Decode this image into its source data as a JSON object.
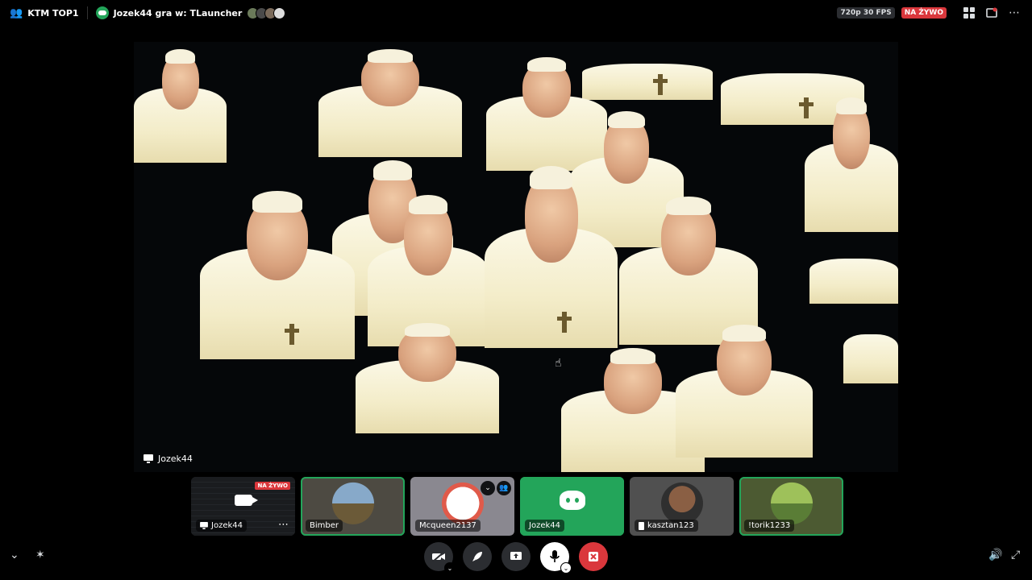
{
  "topbar": {
    "channel_name": "KTM TOP1",
    "activity": "Jozek44 gra w: TLauncher",
    "quality": "720p 30 FPS",
    "live_label": "NA ŻYWO",
    "activity_avatar_colors": [
      "#6b7a5a",
      "#4a4a4a",
      "#7a6a5a",
      "#dddddd"
    ]
  },
  "stream": {
    "streamer_label": "Jozek44"
  },
  "participants": [
    {
      "name": "Jozek44",
      "type": "screen",
      "live_label": "NA ŻYWO",
      "active": false
    },
    {
      "name": "Bimber",
      "type": "avatar",
      "bg": "#4d4a42",
      "avatar_colors": [
        "#87a9c9",
        "#6b5a38"
      ],
      "active": true
    },
    {
      "name": "Mcqueen2137",
      "type": "avatar",
      "bg": "#8a8890",
      "avatar_colors": [
        "#ffffff",
        "#e05a4a"
      ],
      "active": false,
      "hovered": true
    },
    {
      "name": "Jozek44",
      "type": "discord",
      "bg": "#23a55a",
      "active": true
    },
    {
      "name": "kasztan123",
      "type": "avatar",
      "bg": "#505050",
      "avatar_colors": [
        "#8a5f44",
        "#2f2f2f"
      ],
      "active": false
    },
    {
      "name": "!torik1233",
      "type": "avatar",
      "bg": "#4c5a32",
      "avatar_colors": [
        "#9ec15a",
        "#5a7d36"
      ],
      "active": true
    }
  ],
  "controls": {
    "camera_icon": "camera-off-icon",
    "activity_icon": "rocket-icon",
    "share_icon": "screen-share-icon",
    "mic_icon": "microphone-icon",
    "leave_icon": "leave-call-icon"
  }
}
